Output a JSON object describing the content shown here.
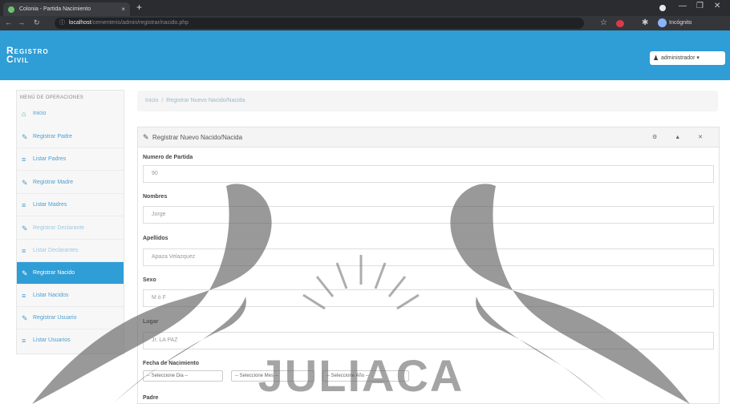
{
  "browser": {
    "tab_title": "Colonia - Partida Nacimiento",
    "tab_close": "×",
    "new_tab": "+",
    "url_host": "localhost",
    "url_path": "/cementerio/admin/registrar/nacido.php",
    "profile_label": "Incógnito",
    "window_controls": [
      "—",
      "❐",
      "✕"
    ]
  },
  "app": {
    "brand_line1": "Registro",
    "brand_line2": "Civil",
    "user_button": "administrador ▾"
  },
  "sidebar": {
    "title": "MENÚ DE OPERACIONES",
    "items": [
      {
        "label": "Inicio",
        "icon": "home-icon"
      },
      {
        "label": "Registrar Padre",
        "icon": "edit-icon"
      },
      {
        "label": "Listar Padres",
        "icon": "list-icon"
      },
      {
        "label": "Registrar Madre",
        "icon": "edit-icon"
      },
      {
        "label": "Listar Madres",
        "icon": "list-icon"
      },
      {
        "label": "Registrar Declarante",
        "icon": "edit-icon"
      },
      {
        "label": "Listar Declarantes",
        "icon": "list-icon"
      },
      {
        "label": "Registrar Nacido",
        "icon": "edit-icon"
      },
      {
        "label": "Listar Nacidos",
        "icon": "list-icon"
      },
      {
        "label": "Registrar Usuario",
        "icon": "edit-icon"
      },
      {
        "label": "Listar Usuarios",
        "icon": "list-icon"
      }
    ]
  },
  "breadcrumb": {
    "home": "Inicio",
    "separator": "/",
    "current": "Registrar Nuevo Nacido/Nacida"
  },
  "panel": {
    "title": "Registrar Nuevo Nacido/Nacida",
    "tools": "⚙ ▲ ✕",
    "fields": [
      {
        "label": "Numero de Partida",
        "placeholder": "90"
      },
      {
        "label": "Nombres",
        "placeholder": "Jorge"
      },
      {
        "label": "Apellidos",
        "placeholder": "Apaza Velazquez"
      },
      {
        "label": "Sexo",
        "placeholder": "M ó F"
      },
      {
        "label": "Lugar",
        "placeholder": "Jr. LA PAZ"
      }
    ],
    "birth_label": "Fecha de Nacimiento",
    "selects": [
      "-- Seleccione Dia --",
      "-- Seleccione Mes --",
      "-- Seleccione Año --"
    ],
    "next_label": "Padre"
  },
  "watermark": {
    "text": "JULIACA"
  },
  "colors": {
    "accent": "#2f9dd6",
    "browser_dark": "#2b2c30"
  }
}
